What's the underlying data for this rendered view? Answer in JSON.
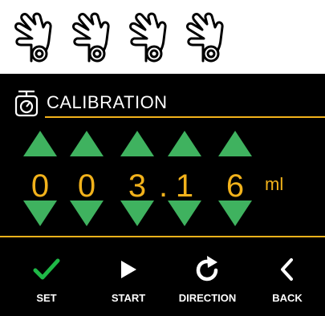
{
  "colors": {
    "accent": "#f2b21b",
    "arrow": "#3fb25f",
    "check": "#1fb847",
    "screen_bg": "#000000",
    "text": "#ffffff"
  },
  "gestures": [
    {
      "icon": "touch-hand-icon"
    },
    {
      "icon": "touch-hand-icon"
    },
    {
      "icon": "touch-hand-icon"
    },
    {
      "icon": "touch-hand-icon"
    }
  ],
  "header": {
    "icon": "scale-icon",
    "title": "CALIBRATION"
  },
  "value": {
    "digits": [
      "0",
      "0",
      "3",
      "1",
      "6"
    ],
    "decimal_point": ".",
    "unit": "ml"
  },
  "buttons": {
    "set": {
      "label": "SET",
      "icon": "checkmark-icon"
    },
    "start": {
      "label": "START",
      "icon": "play-icon"
    },
    "direction": {
      "label": "DIRECTION",
      "icon": "rotate-icon"
    },
    "back": {
      "label": "BACK",
      "icon": "chevron-left-icon"
    }
  }
}
